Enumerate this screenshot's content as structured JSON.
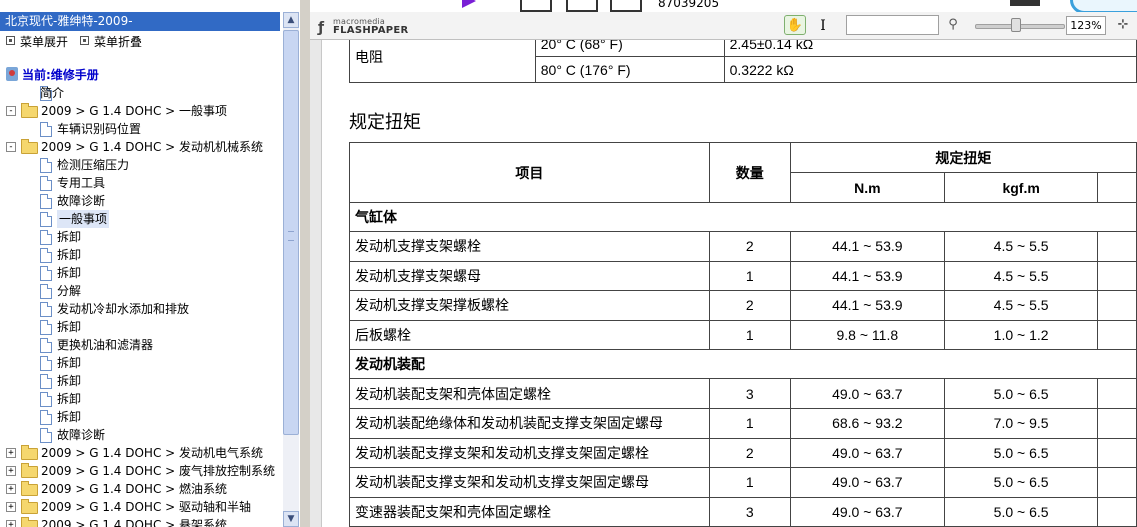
{
  "left_panel": {
    "title": "北京现代-雅绅特-2009-",
    "expand_label": "菜单展开",
    "collapse_label": "菜单折叠",
    "tree": [
      {
        "level": 0,
        "icon": "book",
        "label": "当前:维修手册",
        "current": true
      },
      {
        "level": 1,
        "icon": "doc",
        "label": "简介"
      },
      {
        "level": 0,
        "icon": "folder",
        "toggle": "-",
        "label": "2009 > G 1.4 DOHC > 一般事项"
      },
      {
        "level": 1,
        "icon": "doc",
        "label": "车辆识别码位置"
      },
      {
        "level": 0,
        "icon": "folder",
        "toggle": "-",
        "label": "2009 > G 1.4 DOHC > 发动机机械系统"
      },
      {
        "level": 1,
        "icon": "doc",
        "label": "检测压缩压力"
      },
      {
        "level": 1,
        "icon": "doc",
        "label": "专用工具"
      },
      {
        "level": 1,
        "icon": "doc",
        "label": "故障诊断"
      },
      {
        "level": 1,
        "icon": "doc",
        "label": "一般事项",
        "selected": true
      },
      {
        "level": 1,
        "icon": "doc",
        "label": "拆卸"
      },
      {
        "level": 1,
        "icon": "doc",
        "label": "拆卸"
      },
      {
        "level": 1,
        "icon": "doc",
        "label": "拆卸"
      },
      {
        "level": 1,
        "icon": "doc",
        "label": "分解"
      },
      {
        "level": 1,
        "icon": "doc",
        "label": "发动机冷却水添加和排放"
      },
      {
        "level": 1,
        "icon": "doc",
        "label": "拆卸"
      },
      {
        "level": 1,
        "icon": "doc",
        "label": "更换机油和滤清器"
      },
      {
        "level": 1,
        "icon": "doc",
        "label": "拆卸"
      },
      {
        "level": 1,
        "icon": "doc",
        "label": "拆卸"
      },
      {
        "level": 1,
        "icon": "doc",
        "label": "拆卸"
      },
      {
        "level": 1,
        "icon": "doc",
        "label": "拆卸"
      },
      {
        "level": 1,
        "icon": "doc",
        "label": "故障诊断"
      },
      {
        "level": 0,
        "icon": "folder",
        "toggle": "+",
        "label": "2009 > G 1.4 DOHC > 发动机电气系统"
      },
      {
        "level": 0,
        "icon": "folder",
        "toggle": "+",
        "label": "2009 > G 1.4 DOHC > 废气排放控制系统"
      },
      {
        "level": 0,
        "icon": "folder",
        "toggle": "+",
        "label": "2009 > G 1.4 DOHC > 燃油系统"
      },
      {
        "level": 0,
        "icon": "folder",
        "toggle": "+",
        "label": "2009 > G 1.4 DOHC > 驱动轴和半轴"
      },
      {
        "level": 0,
        "icon": "folder",
        "toggle": "+",
        "label": "2009 > G 1.4 DOHC > 悬架系统"
      }
    ]
  },
  "browser_strip": {
    "phone_text": "87039205"
  },
  "viewer_toolbar": {
    "logo_top": "macromedia",
    "logo_bottom": "FLASHPAPER",
    "hand_icon": "hand-icon",
    "text_select_icon": "text-cursor-icon",
    "find_placeholder": "",
    "search_icon": "magnifier-icon",
    "zoom_level": "123%",
    "zoom_fraction": 0.45,
    "fit_icon": "fit-page-icon"
  },
  "document": {
    "resistance_table": {
      "label": "电阻",
      "rows": [
        {
          "temp": "20° C (68° F)",
          "value": "2.45±0.14 kΩ"
        },
        {
          "temp": "80° C (176° F)",
          "value": "0.3222 kΩ"
        }
      ]
    },
    "section_title": "规定扭矩",
    "torque_table": {
      "header_item": "项目",
      "header_qty": "数量",
      "header_torque": "规定扭矩",
      "header_nm": "N.m",
      "header_kgfm": "kgf.m",
      "groups": [
        {
          "name": "气缸体",
          "rows": [
            {
              "item": "发动机支撑支架螺栓",
              "qty": "2",
              "nm": "44.1 ~ 53.9",
              "kgfm": "4.5 ~ 5.5"
            },
            {
              "item": "发动机支撑支架螺母",
              "qty": "1",
              "nm": "44.1 ~ 53.9",
              "kgfm": "4.5 ~ 5.5"
            },
            {
              "item": "发动机支撑支架撑板螺栓",
              "qty": "2",
              "nm": "44.1 ~ 53.9",
              "kgfm": "4.5 ~ 5.5"
            },
            {
              "item": "后板螺栓",
              "qty": "1",
              "nm": "9.8 ~ 11.8",
              "kgfm": "1.0 ~ 1.2"
            }
          ]
        },
        {
          "name": "发动机装配",
          "rows": [
            {
              "item": "发动机装配支架和壳体固定螺栓",
              "qty": "3",
              "nm": "49.0 ~ 63.7",
              "kgfm": "5.0 ~ 6.5"
            },
            {
              "item": "发动机装配绝缘体和发动机装配支撑支架固定螺母",
              "qty": "1",
              "nm": "68.6 ~ 93.2",
              "kgfm": "7.0 ~ 9.5"
            },
            {
              "item": "发动机装配支撑支架和发动机支撑支架固定螺栓",
              "qty": "2",
              "nm": "49.0 ~ 63.7",
              "kgfm": "5.0 ~ 6.5"
            },
            {
              "item": "发动机装配支撑支架和发动机支撑支架固定螺母",
              "qty": "1",
              "nm": "49.0 ~ 63.7",
              "kgfm": "5.0 ~ 6.5"
            },
            {
              "item": "变速器装配支架和壳体固定螺栓",
              "qty": "3",
              "nm": "49.0 ~ 63.7",
              "kgfm": "5.0 ~ 6.5"
            }
          ]
        }
      ]
    }
  }
}
